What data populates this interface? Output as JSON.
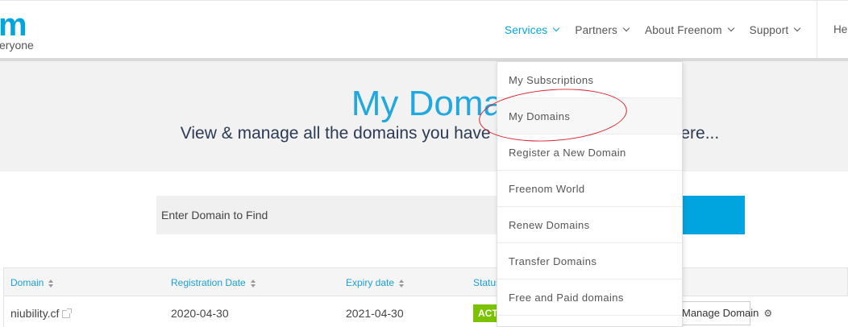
{
  "header": {
    "logo_mark": "m",
    "logo_tagline": "eryone",
    "nav": [
      {
        "label": "Services",
        "active": true
      },
      {
        "label": "Partners",
        "active": false
      },
      {
        "label": "About Freenom",
        "active": false
      },
      {
        "label": "Support",
        "active": false
      }
    ],
    "help_label": "He"
  },
  "hero": {
    "title": "My Domains",
    "subtitle": "View & manage all the domains you have registered with us from here..."
  },
  "search": {
    "placeholder": "Enter Domain to Find"
  },
  "table": {
    "headers": [
      "Domain",
      "Registration Date",
      "Expiry date",
      "Status"
    ],
    "rows": [
      {
        "domain": "niubility.cf",
        "registration_date": "2020-04-30",
        "expiry_date": "2021-04-30",
        "status": "ACTIVE",
        "action": "Manage Domain"
      }
    ]
  },
  "dropdown": {
    "items": [
      "My Subscriptions",
      "My Domains",
      "Register a New Domain",
      "Freenom World",
      "Renew Domains",
      "Transfer Domains",
      "Free and Paid domains"
    ]
  },
  "colors": {
    "accent": "#00a5df",
    "hero_bg": "#f2f2f2",
    "status_active": "#7bc300",
    "annotation": "#d9232e"
  }
}
